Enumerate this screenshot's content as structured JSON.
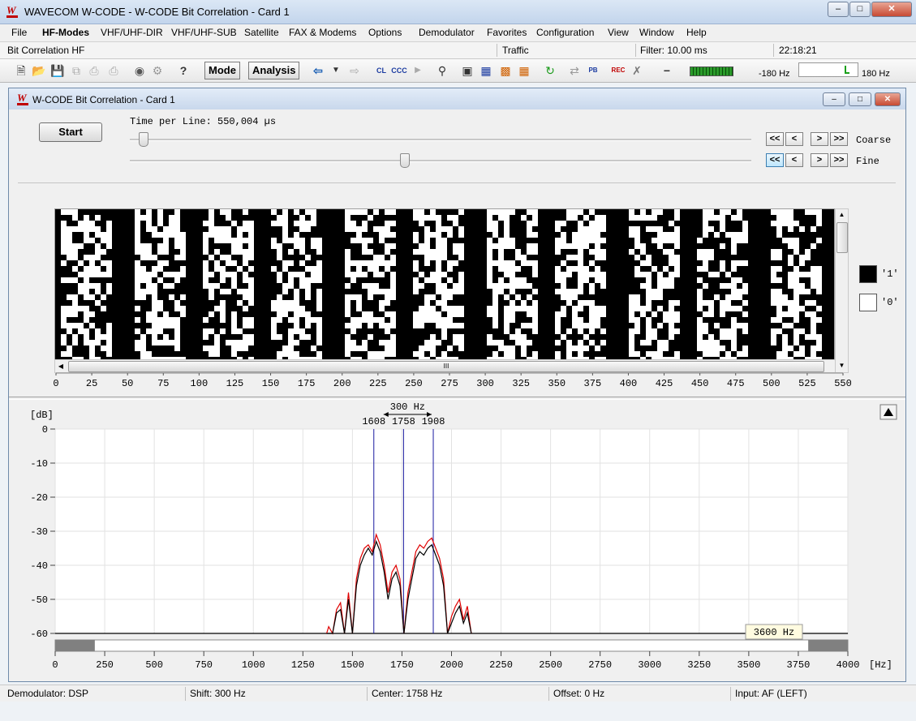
{
  "app": {
    "title": "WAVECOM W-CODE - W-CODE Bit Correlation  - Card 1",
    "logo_text": "W"
  },
  "menu": [
    "File",
    "HF-Modes",
    "VHF/UHF-DIR",
    "VHF/UHF-SUB",
    "Satellite",
    "FAX & Modems",
    "Options",
    "Demodulator",
    "Favorites",
    "Configuration",
    "View",
    "Window",
    "Help"
  ],
  "infobar": {
    "mode": "Bit Correlation HF",
    "traffic": "Traffic",
    "filter": "Filter: 10.00 ms",
    "time": "22:18:21"
  },
  "toolbar": {
    "mode_label": "Mode",
    "analysis_label": "Analysis",
    "tuning_left": "-180 Hz",
    "tuning_right": "180 Hz"
  },
  "inner": {
    "title": "W-CODE Bit Correlation  - Card 1",
    "start_label": "Start",
    "time_per_line": "Time per Line: 550,004 µs",
    "coarse_label": "Coarse",
    "fine_label": "Fine",
    "coarse_slider_pct": 1.5,
    "fine_slider_pct": 43.5
  },
  "bitmap": {
    "ticks": [
      "0",
      "25",
      "50",
      "75",
      "100",
      "125",
      "150",
      "175",
      "200",
      "225",
      "250",
      "275",
      "300",
      "325",
      "350",
      "375",
      "400",
      "425",
      "450",
      "475",
      "500",
      "525",
      "550"
    ],
    "legend_one": "'1'",
    "legend_zero": "'0'",
    "scroll_grip": "III"
  },
  "spectrum": {
    "ylabel": "[dB]",
    "xunit": "[Hz]",
    "span_label": "300 Hz",
    "markers": [
      "1608",
      "1758",
      "1908"
    ],
    "range_label": "3600 Hz",
    "yticks": [
      "0",
      "-10",
      "-20",
      "-30",
      "-40",
      "-50",
      "-60"
    ],
    "xticks": [
      "0",
      "250",
      "500",
      "750",
      "1000",
      "1250",
      "1500",
      "1750",
      "2000",
      "2250",
      "2500",
      "2750",
      "3000",
      "3250",
      "3500",
      "3750",
      "4000"
    ],
    "colors": {
      "black_trace": "#000000",
      "red_trace": "#e00000",
      "marker": "#1a1aa0"
    }
  },
  "chart_data": {
    "type": "line",
    "xlabel": "[Hz]",
    "ylabel": "[dB]",
    "xlim": [
      0,
      4000
    ],
    "ylim": [
      -60,
      0
    ],
    "grid": true,
    "markers_hz": [
      1608,
      1758,
      1908
    ],
    "series": [
      {
        "color": "#e00000",
        "x": [
          1370,
          1380,
          1400,
          1420,
          1440,
          1460,
          1480,
          1500,
          1520,
          1540,
          1560,
          1580,
          1600,
          1620,
          1640,
          1660,
          1680,
          1700,
          1720,
          1740,
          1760,
          1780,
          1800,
          1820,
          1840,
          1860,
          1880,
          1900,
          1920,
          1940,
          1960,
          1980,
          2000,
          2020,
          2040,
          2060,
          2080,
          2100
        ],
        "y": [
          -60,
          -58,
          -60,
          -53,
          -51,
          -60,
          -48,
          -60,
          -44,
          -38,
          -35,
          -34,
          -36,
          -31,
          -34,
          -40,
          -48,
          -42,
          -40,
          -44,
          -60,
          -48,
          -42,
          -36,
          -34,
          -35,
          -33,
          -32,
          -35,
          -38,
          -44,
          -60,
          -55,
          -52,
          -50,
          -56,
          -52,
          -60
        ]
      },
      {
        "color": "#000000",
        "x": [
          1370,
          1400,
          1420,
          1440,
          1460,
          1480,
          1500,
          1520,
          1540,
          1560,
          1580,
          1600,
          1620,
          1640,
          1660,
          1680,
          1700,
          1720,
          1740,
          1760,
          1780,
          1800,
          1820,
          1840,
          1860,
          1880,
          1900,
          1920,
          1940,
          1960,
          1980,
          2000,
          2020,
          2040,
          2060,
          2080,
          2100
        ],
        "y": [
          -60,
          -60,
          -54,
          -53,
          -60,
          -50,
          -60,
          -46,
          -40,
          -37,
          -35,
          -37,
          -33,
          -36,
          -42,
          -50,
          -44,
          -42,
          -46,
          -60,
          -50,
          -44,
          -38,
          -36,
          -37,
          -35,
          -34,
          -37,
          -40,
          -46,
          -60,
          -57,
          -54,
          -52,
          -57,
          -54,
          -60
        ]
      }
    ]
  },
  "statusbar": {
    "demod": "Demodulator: DSP",
    "shift": "Shift: 300 Hz",
    "center": "Center: 1758 Hz",
    "offset": "Offset: 0 Hz",
    "input": "Input: AF (LEFT)"
  }
}
